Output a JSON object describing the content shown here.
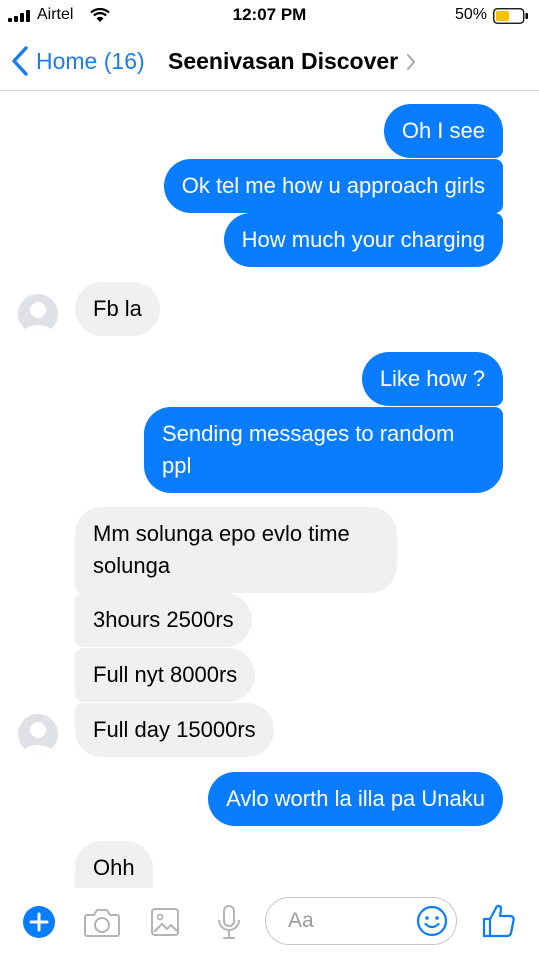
{
  "status_bar": {
    "carrier": "Airtel",
    "time": "12:07 PM",
    "battery_percent": "50%",
    "battery_level": 0.5,
    "battery_color": "#f5c400"
  },
  "header": {
    "back_label": "Home (16)",
    "contact_name": "Seenivasan Discover",
    "accent_color": "#1b7cf4"
  },
  "messages": [
    {
      "side": "out",
      "text": "Oh I see"
    },
    {
      "side": "out",
      "text": "Ok tel me how u approach girls"
    },
    {
      "side": "out",
      "text": "How much your charging"
    },
    {
      "side": "in",
      "text": "Fb la"
    },
    {
      "side": "out",
      "text": "Like how ?"
    },
    {
      "side": "out",
      "text": "Sending messages to random ppl"
    },
    {
      "side": "in",
      "text": "Mm solunga epo evlo time solunga"
    },
    {
      "side": "in",
      "text": "3hours 2500rs"
    },
    {
      "side": "in",
      "text": "Full nyt 8000rs"
    },
    {
      "side": "in",
      "text": "Full day 15000rs"
    },
    {
      "side": "out",
      "text": "Avlo worth la illa pa Unaku"
    },
    {
      "side": "in",
      "text": "Ohh"
    }
  ],
  "colors": {
    "outgoing_bubble": "#0a7cff",
    "incoming_bubble": "#f0f0f0"
  },
  "composer": {
    "placeholder": "Aa"
  },
  "toolbar_icons": [
    "plus-icon",
    "camera-icon",
    "image-icon",
    "microphone-icon",
    "emoji-icon",
    "thumbs-up-icon"
  ]
}
